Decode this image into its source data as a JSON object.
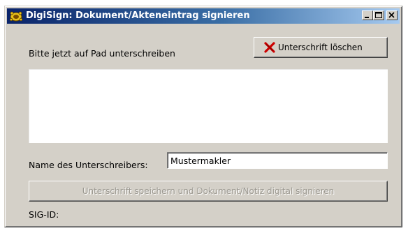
{
  "window": {
    "title": "DigiSign: Dokument/Akteneintrag signieren",
    "icon": "digisign-app-icon",
    "controls": [
      "minimize-icon",
      "maximize-icon",
      "close-icon"
    ]
  },
  "prompt_text": "Bitte jetzt auf Pad unterschreiben",
  "clear_button": {
    "label": "Unterschrift löschen",
    "icon": "red-x-icon",
    "icon_color": "#cc0000"
  },
  "signer": {
    "label": "Name des Unterschreibers:",
    "value": "Mustermakler"
  },
  "sign_button": {
    "label": "Unterschrift speichern und Dokument/Notiz digital signieren",
    "enabled": false
  },
  "sig_id": {
    "label": "SIG-ID:",
    "value": ""
  },
  "colors": {
    "titlebar_start": "#0a246a",
    "titlebar_end": "#a6caf0",
    "dialog_bg": "#d4d0c8"
  }
}
